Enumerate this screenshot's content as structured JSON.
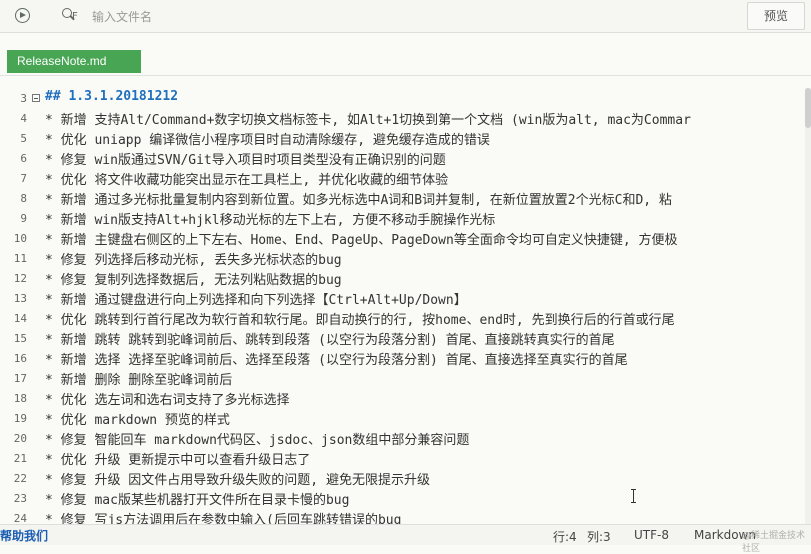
{
  "toolbar": {
    "filter_label": "F",
    "search_placeholder": "输入文件名",
    "preview_label": "预览"
  },
  "tabs": [
    {
      "label": "ReleaseNote.md"
    }
  ],
  "editor": {
    "lines": [
      {
        "num": "3",
        "text": "## 1.3.1.20181212",
        "heading": true,
        "fold": true
      },
      {
        "num": "4",
        "text": "* 新增 支持Alt/Command+数字切换文档标签卡, 如Alt+1切换到第一个文档 (win版为alt, mac为Commar"
      },
      {
        "num": "5",
        "text": "* 优化 uniapp 编译微信小程序项目时自动清除缓存, 避免缓存造成的错误"
      },
      {
        "num": "6",
        "text": "* 修复 win版通过SVN/Git导入项目时项目类型没有正确识别的问题"
      },
      {
        "num": "7",
        "text": "* 优化 将文件收藏功能突出显示在工具栏上, 并优化收藏的细节体验"
      },
      {
        "num": "8",
        "text": "* 新增 通过多光标批量复制内容到新位置。如多光标选中A词和B词并复制, 在新位置放置2个光标C和D, 粘"
      },
      {
        "num": "9",
        "text": "* 新增 win版支持Alt+hjkl移动光标的左下上右, 方便不移动手腕操作光标"
      },
      {
        "num": "10",
        "text": "* 新增 主键盘右侧区的上下左右、Home、End、PageUp、PageDown等全面命令均可自定义快捷键, 方便极"
      },
      {
        "num": "11",
        "text": "* 修复 列选择后移动光标, 丢失多光标状态的bug"
      },
      {
        "num": "12",
        "text": "* 修复 复制列选择数据后, 无法列粘贴数据的bug"
      },
      {
        "num": "13",
        "text": "* 新增 通过键盘进行向上列选择和向下列选择【Ctrl+Alt+Up/Down】"
      },
      {
        "num": "14",
        "text": "* 优化 跳转到行首行尾改为软行首和软行尾。即自动换行的行, 按home、end时, 先到换行后的行首或行尾"
      },
      {
        "num": "15",
        "text": "* 新增 跳转 跳转到驼峰词前后、跳转到段落 (以空行为段落分割) 首尾、直接跳转真实行的首尾"
      },
      {
        "num": "16",
        "text": "* 新增 选择 选择至驼峰词前后、选择至段落 (以空行为段落分割) 首尾、直接选择至真实行的首尾"
      },
      {
        "num": "17",
        "text": "* 新增 删除 删除至驼峰词前后"
      },
      {
        "num": "18",
        "text": "* 优化 选左词和选右词支持了多光标选择"
      },
      {
        "num": "19",
        "text": "* 优化 markdown 预览的样式"
      },
      {
        "num": "20",
        "text": "* 修复 智能回车 markdown代码区、jsdoc、json数组中部分兼容问题"
      },
      {
        "num": "21",
        "text": "* 优化 升级 更新提示中可以查看升级日志了"
      },
      {
        "num": "22",
        "text": "* 修复 升级 因文件占用导致升级失败的问题, 避免无限提示升级"
      },
      {
        "num": "23",
        "text": "* 修复 mac版某些机器打开文件所在目录卡慢的bug"
      },
      {
        "num": "24",
        "text": "* 修复 写js方法调用后在参数中输入(后回车跳转错误的bug"
      }
    ]
  },
  "statusbar": {
    "help_link": "帮助我们",
    "row": "行:4",
    "col": "列:3",
    "encoding": "UTF-8",
    "language": "Markdown",
    "watermark": "@稀土掘金技术社区"
  }
}
